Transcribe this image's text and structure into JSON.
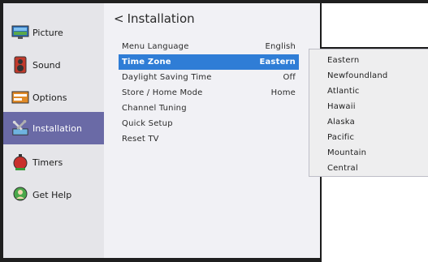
{
  "sidebar": {
    "items": [
      {
        "label": "Picture",
        "icon": "picture-icon"
      },
      {
        "label": "Sound",
        "icon": "sound-icon"
      },
      {
        "label": "Options",
        "icon": "options-icon"
      },
      {
        "label": "Installation",
        "icon": "installation-icon",
        "active": true
      },
      {
        "label": "Timers",
        "icon": "timers-icon"
      },
      {
        "label": "Get Help",
        "icon": "help-icon"
      }
    ]
  },
  "main": {
    "back_glyph": "<",
    "title": "Installation",
    "rows": [
      {
        "label": "Menu Language",
        "value": "English"
      },
      {
        "label": "Time Zone",
        "value": "Eastern",
        "selected": true
      },
      {
        "label": "Daylight Saving Time",
        "value": "Off"
      },
      {
        "label": "Store / Home Mode",
        "value": "Home"
      },
      {
        "label": "Channel Tuning",
        "value": ""
      },
      {
        "label": "Quick Setup",
        "value": ""
      },
      {
        "label": "Reset TV",
        "value": ""
      }
    ]
  },
  "dropdown": {
    "options": [
      "Eastern",
      "Newfoundland",
      "Atlantic",
      "Hawaii",
      "Alaska",
      "Pacific",
      "Mountain",
      "Central"
    ]
  },
  "colors": {
    "selected_row": "#2f7dd6",
    "active_sidebar": "#6a6aa6"
  }
}
